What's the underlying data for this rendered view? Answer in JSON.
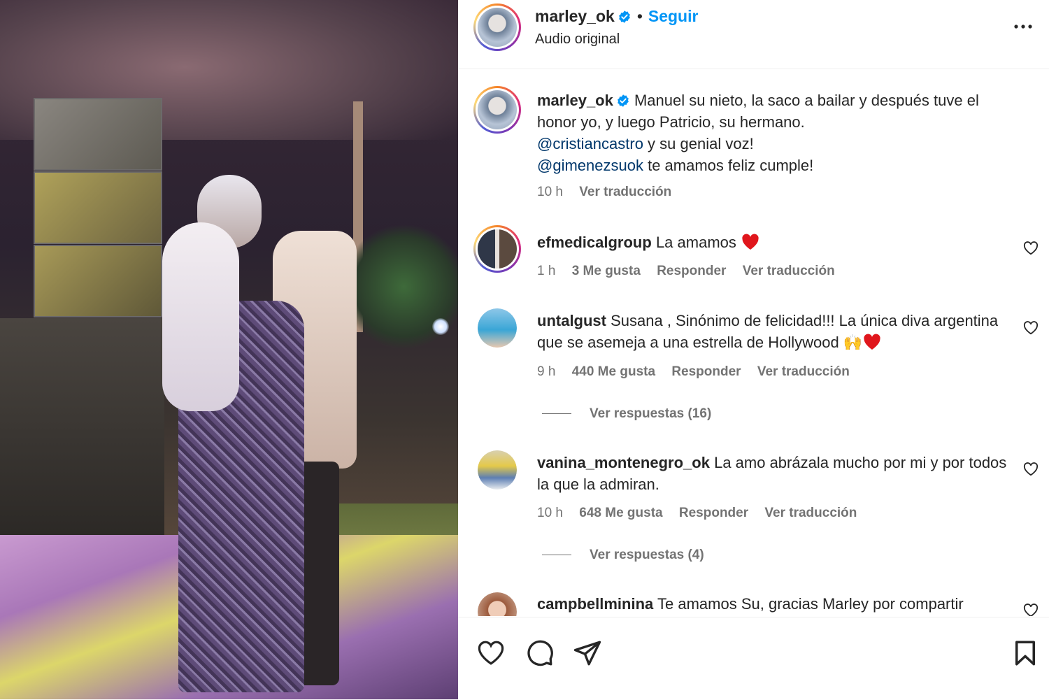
{
  "header": {
    "username": "marley_ok",
    "separator": "•",
    "follow_label": "Seguir",
    "audio_label": "Audio original"
  },
  "caption": {
    "username": "marley_ok",
    "line1": "Manuel su nieto, la saco a bailar y después tuve el honor yo, y luego Patricio, su hermano.",
    "mention1": "@cristiancastro",
    "line2": " y su genial voz!",
    "mention2": "@gimenezsuok",
    "line3": " te amamos feliz cumple!",
    "time": "10 h",
    "translate": "Ver traducción"
  },
  "comments": [
    {
      "username": "efmedicalgroup",
      "text": "La amamos",
      "emoji": "heart",
      "time": "1 h",
      "likes": "3 Me gusta",
      "reply": "Responder",
      "translate": "Ver traducción"
    },
    {
      "username": "untalgust",
      "text": "Susana , Sinónimo de felicidad!!! La única diva argentina que se asemeja a una estrella de Hollywood",
      "emoji": "raised-hands heart",
      "time": "9 h",
      "likes": "440 Me gusta",
      "reply": "Responder",
      "translate": "Ver traducción",
      "replies": "Ver respuestas (16)"
    },
    {
      "username": "vanina_montenegro_ok",
      "text": "La amo abrázala mucho por mi y por todos la que la admiran.",
      "time": "10 h",
      "likes": "648 Me gusta",
      "reply": "Responder",
      "translate": "Ver traducción",
      "replies": "Ver respuestas (4)"
    },
    {
      "username": "campbellminina",
      "text": "Te amamos Su, gracias Marley por compartir"
    }
  ],
  "icons": {
    "verified": "verified-badge-icon",
    "more": "more-options-icon",
    "like": "heart-icon",
    "comment": "comment-icon",
    "share": "share-icon",
    "save": "bookmark-icon"
  },
  "colors": {
    "link": "#0095f6",
    "mention": "#00376b",
    "secondary": "#737373",
    "heart_red": "#ed4956"
  }
}
